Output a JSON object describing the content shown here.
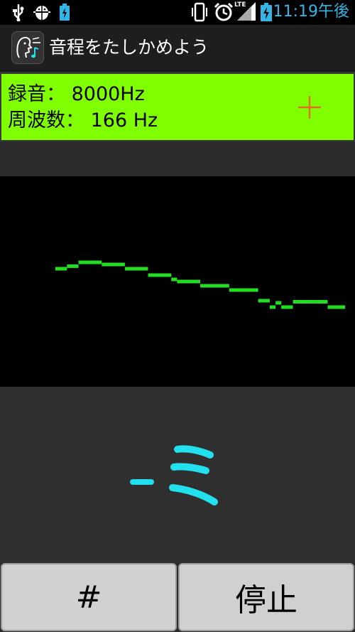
{
  "statusbar": {
    "time": "11:19午後",
    "lte_label": "LTE",
    "icons": [
      "usb-icon",
      "android-debug-icon",
      "battery-charging-small-icon",
      "vibrate-icon",
      "alarm-icon",
      "signal-icon",
      "battery-icon"
    ]
  },
  "app": {
    "title": "音程をたしかめよう",
    "icon": "singing-face-music-note-icon"
  },
  "info": {
    "recording_label": "録音：",
    "recording_value": "8000Hz",
    "frequency_label": "周波数：",
    "frequency_value": "166 Hz",
    "plus_icon": "plus-icon",
    "accent": "#80ff00"
  },
  "graph": {
    "trace_color": "#22dd22",
    "points": [
      [
        0.0,
        0.0
      ],
      [
        0.04,
        0.012
      ],
      [
        0.08,
        0.03
      ],
      [
        0.16,
        0.02
      ],
      [
        0.24,
        0.0
      ],
      [
        0.32,
        -0.03
      ],
      [
        0.4,
        -0.05
      ],
      [
        0.42,
        -0.06
      ],
      [
        0.5,
        -0.08
      ],
      [
        0.6,
        -0.1
      ],
      [
        0.7,
        -0.15
      ],
      [
        0.74,
        -0.18
      ],
      [
        0.76,
        -0.16
      ],
      [
        0.78,
        -0.18
      ],
      [
        0.82,
        -0.155
      ],
      [
        0.9,
        -0.155
      ],
      [
        0.94,
        -0.18
      ],
      [
        1.0,
        -0.18
      ]
    ]
  },
  "note": {
    "dash": "-",
    "syllable": "ミ",
    "color": "#22e0ee"
  },
  "buttons": {
    "sharp": "#",
    "stop": "停止"
  }
}
